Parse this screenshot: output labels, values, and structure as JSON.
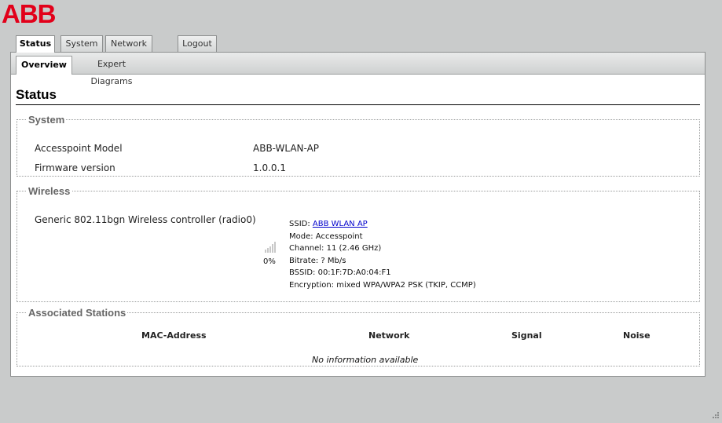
{
  "brand": {
    "logo_text": "ABB",
    "color": "#e2001a"
  },
  "tabs": [
    {
      "label": "Status",
      "active": true
    },
    {
      "label": "System",
      "active": false
    },
    {
      "label": "Network",
      "active": false
    },
    {
      "label": "Logout",
      "active": false
    }
  ],
  "subtabs": [
    {
      "label": "Overview",
      "active": true
    },
    {
      "label": "Expert Diagrams",
      "active": false
    }
  ],
  "page_title": "Status",
  "system": {
    "legend": "System",
    "rows": [
      {
        "label": "Accesspoint Model",
        "value": "ABB-WLAN-AP"
      },
      {
        "label": "Firmware version",
        "value": "1.0.0.1"
      }
    ]
  },
  "wireless": {
    "legend": "Wireless",
    "device": "Generic 802.11bgn Wireless controller (radio0)",
    "signal_percent": "0%",
    "signal_icon": "signal-strength-icon",
    "ssid_label": "SSID:",
    "ssid_value": "ABB WLAN AP",
    "mode": "Mode: Accesspoint",
    "channel": "Channel: 11 (2.46 GHz)",
    "bitrate": "Bitrate: ? Mb/s",
    "bssid": "BSSID: 00:1F:7D:A0:04:F1",
    "encryption": "Encryption: mixed WPA/WPA2 PSK (TKIP, CCMP)"
  },
  "stations": {
    "legend": "Associated Stations",
    "columns": [
      "MAC-Address",
      "Network",
      "Signal",
      "Noise"
    ],
    "empty_text": "No information available"
  }
}
